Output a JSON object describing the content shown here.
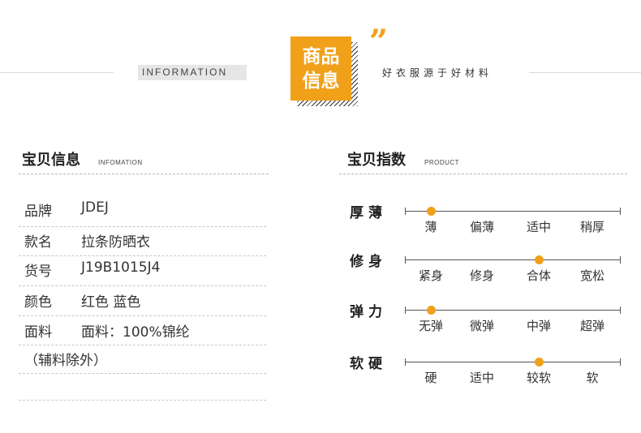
{
  "header": {
    "info_tag": "INFORMATION",
    "badge_line1": "商品",
    "badge_line2": "信息",
    "quote_mark": "”",
    "slogan": "好衣服源于好材料"
  },
  "left_section": {
    "title": "宝贝信息",
    "subtitle": "INFOMATION",
    "rows": [
      {
        "key": "品牌",
        "value": "JDEJ"
      },
      {
        "key": "款名",
        "value": "拉条防晒衣"
      },
      {
        "key": "货号",
        "value": "J19B1015J4"
      },
      {
        "key": "颜色",
        "value": "红色 蓝色"
      },
      {
        "key": "面料",
        "value": "面料：100%锦纶"
      }
    ],
    "note": "（辅料除外）"
  },
  "right_section": {
    "title": "宝贝指数",
    "subtitle": "PRODUCT",
    "indices": [
      {
        "label": "厚薄",
        "options": [
          "薄",
          "偏薄",
          "适中",
          "稍厚"
        ],
        "selected": 0
      },
      {
        "label": "修身",
        "options": [
          "紧身",
          "修身",
          "合体",
          "宽松"
        ],
        "selected": 2
      },
      {
        "label": "弹力",
        "options": [
          "无弹",
          "微弹",
          "中弹",
          "超弹"
        ],
        "selected": 0
      },
      {
        "label": "软硬",
        "options": [
          "硬",
          "适中",
          "较软",
          "软"
        ],
        "selected": 2
      }
    ]
  },
  "colors": {
    "accent": "#f0a019",
    "text": "#222222",
    "line": "#555555"
  }
}
